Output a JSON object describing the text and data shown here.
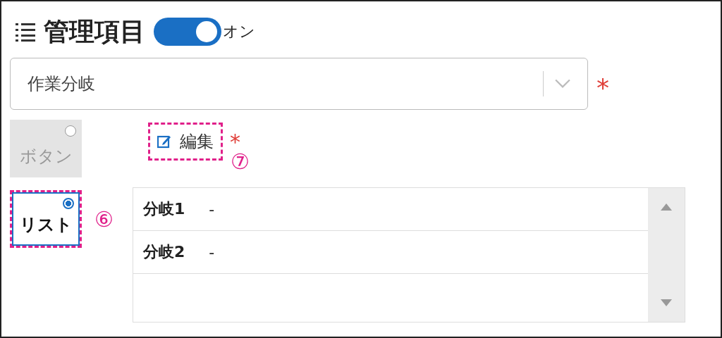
{
  "header": {
    "title": "管理項目",
    "toggle": {
      "on": true,
      "label": "オン"
    }
  },
  "dropdown": {
    "value": "作業分岐",
    "required_mark": "*"
  },
  "modes": [
    {
      "label": "ボタン",
      "selected": false
    },
    {
      "label": "リスト",
      "selected": true
    }
  ],
  "edit_button": {
    "label": "編集",
    "required_mark": "*"
  },
  "callouts": [
    "⑥",
    "⑦"
  ],
  "branches": [
    {
      "name": "分岐1",
      "value": "-"
    },
    {
      "name": "分岐2",
      "value": "-"
    }
  ]
}
